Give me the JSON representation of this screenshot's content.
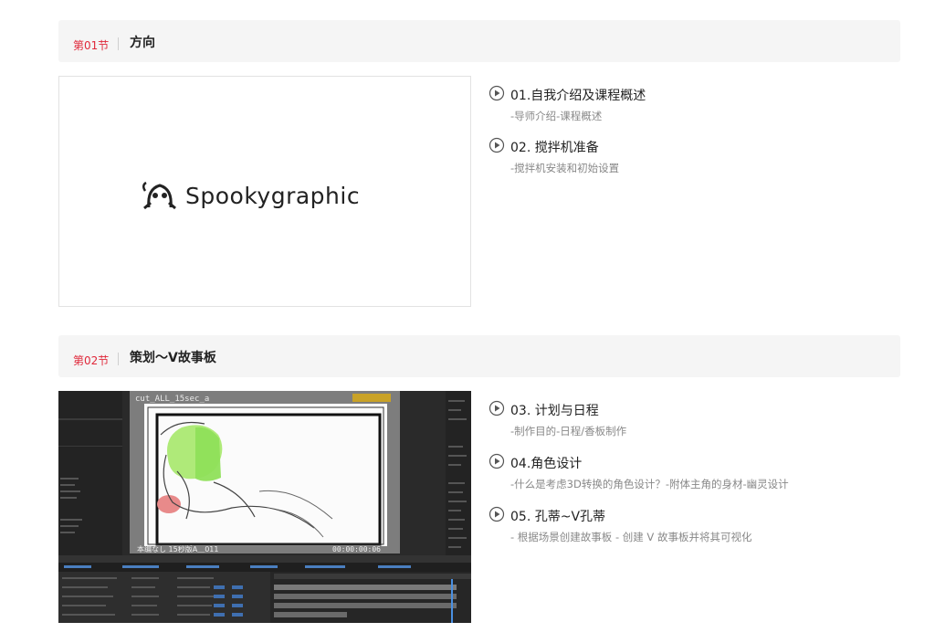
{
  "sections": [
    {
      "num": "第01节",
      "title": "方向",
      "thumbnail": {
        "kind": "logo",
        "logo_text": "Spookygraphic",
        "logo_icon": "ghost-logo-icon"
      },
      "lessons": [
        {
          "title": "01.自我介绍及课程概述",
          "desc": "-导师介绍-课程概述"
        },
        {
          "title": "02. 搅拌机准备",
          "desc": "-搅拌机安装和初始设置"
        }
      ]
    },
    {
      "num": "第02节",
      "title": "策划～V故事板",
      "thumbnail": {
        "kind": "video-editor-screenshot",
        "comp_name": "cut_ALL_15sec_a",
        "timecode": "00:00:00:06",
        "caption": "本编なし 15秒版A＿011"
      },
      "lessons": [
        {
          "title": "03. 计划与日程",
          "desc": "-制作目的-日程/香板制作"
        },
        {
          "title": "04.角色设计",
          "desc": "-什么是考虑3D转换的角色设计？-附体主角的身材-幽灵设计"
        },
        {
          "title": "05. 孔蒂~V孔蒂",
          "desc": "- 根据场景创建故事板 - 创建 V 故事板并将其可视化"
        }
      ]
    }
  ],
  "colors": {
    "accent": "#e0283a",
    "header_bg": "#f5f5f5",
    "desc_text": "#888888"
  },
  "icons": {
    "lesson": "play-circle-icon"
  }
}
